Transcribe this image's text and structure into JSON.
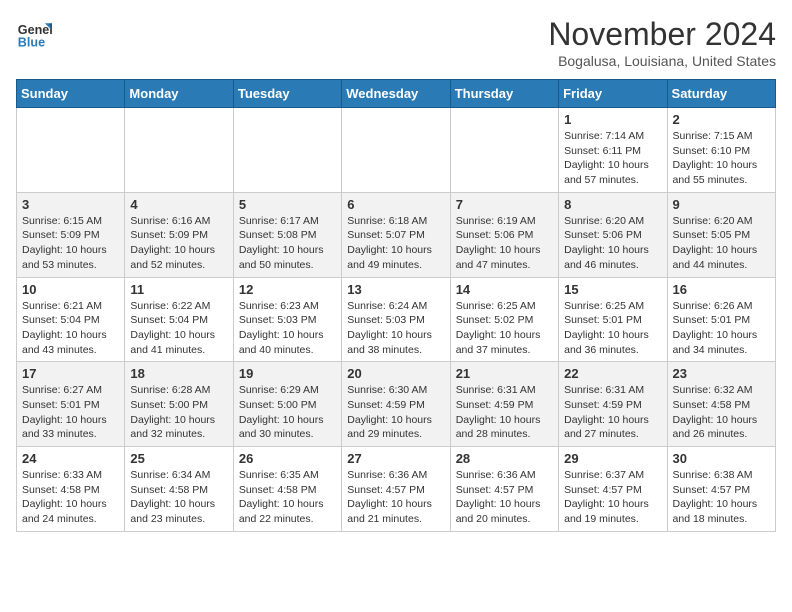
{
  "header": {
    "logo_line1": "General",
    "logo_line2": "Blue",
    "month": "November 2024",
    "location": "Bogalusa, Louisiana, United States"
  },
  "days_of_week": [
    "Sunday",
    "Monday",
    "Tuesday",
    "Wednesday",
    "Thursday",
    "Friday",
    "Saturday"
  ],
  "weeks": [
    [
      {
        "day": "",
        "info": ""
      },
      {
        "day": "",
        "info": ""
      },
      {
        "day": "",
        "info": ""
      },
      {
        "day": "",
        "info": ""
      },
      {
        "day": "",
        "info": ""
      },
      {
        "day": "1",
        "info": "Sunrise: 7:14 AM\nSunset: 6:11 PM\nDaylight: 10 hours and 57 minutes."
      },
      {
        "day": "2",
        "info": "Sunrise: 7:15 AM\nSunset: 6:10 PM\nDaylight: 10 hours and 55 minutes."
      }
    ],
    [
      {
        "day": "3",
        "info": "Sunrise: 6:15 AM\nSunset: 5:09 PM\nDaylight: 10 hours and 53 minutes."
      },
      {
        "day": "4",
        "info": "Sunrise: 6:16 AM\nSunset: 5:09 PM\nDaylight: 10 hours and 52 minutes."
      },
      {
        "day": "5",
        "info": "Sunrise: 6:17 AM\nSunset: 5:08 PM\nDaylight: 10 hours and 50 minutes."
      },
      {
        "day": "6",
        "info": "Sunrise: 6:18 AM\nSunset: 5:07 PM\nDaylight: 10 hours and 49 minutes."
      },
      {
        "day": "7",
        "info": "Sunrise: 6:19 AM\nSunset: 5:06 PM\nDaylight: 10 hours and 47 minutes."
      },
      {
        "day": "8",
        "info": "Sunrise: 6:20 AM\nSunset: 5:06 PM\nDaylight: 10 hours and 46 minutes."
      },
      {
        "day": "9",
        "info": "Sunrise: 6:20 AM\nSunset: 5:05 PM\nDaylight: 10 hours and 44 minutes."
      }
    ],
    [
      {
        "day": "10",
        "info": "Sunrise: 6:21 AM\nSunset: 5:04 PM\nDaylight: 10 hours and 43 minutes."
      },
      {
        "day": "11",
        "info": "Sunrise: 6:22 AM\nSunset: 5:04 PM\nDaylight: 10 hours and 41 minutes."
      },
      {
        "day": "12",
        "info": "Sunrise: 6:23 AM\nSunset: 5:03 PM\nDaylight: 10 hours and 40 minutes."
      },
      {
        "day": "13",
        "info": "Sunrise: 6:24 AM\nSunset: 5:03 PM\nDaylight: 10 hours and 38 minutes."
      },
      {
        "day": "14",
        "info": "Sunrise: 6:25 AM\nSunset: 5:02 PM\nDaylight: 10 hours and 37 minutes."
      },
      {
        "day": "15",
        "info": "Sunrise: 6:25 AM\nSunset: 5:01 PM\nDaylight: 10 hours and 36 minutes."
      },
      {
        "day": "16",
        "info": "Sunrise: 6:26 AM\nSunset: 5:01 PM\nDaylight: 10 hours and 34 minutes."
      }
    ],
    [
      {
        "day": "17",
        "info": "Sunrise: 6:27 AM\nSunset: 5:01 PM\nDaylight: 10 hours and 33 minutes."
      },
      {
        "day": "18",
        "info": "Sunrise: 6:28 AM\nSunset: 5:00 PM\nDaylight: 10 hours and 32 minutes."
      },
      {
        "day": "19",
        "info": "Sunrise: 6:29 AM\nSunset: 5:00 PM\nDaylight: 10 hours and 30 minutes."
      },
      {
        "day": "20",
        "info": "Sunrise: 6:30 AM\nSunset: 4:59 PM\nDaylight: 10 hours and 29 minutes."
      },
      {
        "day": "21",
        "info": "Sunrise: 6:31 AM\nSunset: 4:59 PM\nDaylight: 10 hours and 28 minutes."
      },
      {
        "day": "22",
        "info": "Sunrise: 6:31 AM\nSunset: 4:59 PM\nDaylight: 10 hours and 27 minutes."
      },
      {
        "day": "23",
        "info": "Sunrise: 6:32 AM\nSunset: 4:58 PM\nDaylight: 10 hours and 26 minutes."
      }
    ],
    [
      {
        "day": "24",
        "info": "Sunrise: 6:33 AM\nSunset: 4:58 PM\nDaylight: 10 hours and 24 minutes."
      },
      {
        "day": "25",
        "info": "Sunrise: 6:34 AM\nSunset: 4:58 PM\nDaylight: 10 hours and 23 minutes."
      },
      {
        "day": "26",
        "info": "Sunrise: 6:35 AM\nSunset: 4:58 PM\nDaylight: 10 hours and 22 minutes."
      },
      {
        "day": "27",
        "info": "Sunrise: 6:36 AM\nSunset: 4:57 PM\nDaylight: 10 hours and 21 minutes."
      },
      {
        "day": "28",
        "info": "Sunrise: 6:36 AM\nSunset: 4:57 PM\nDaylight: 10 hours and 20 minutes."
      },
      {
        "day": "29",
        "info": "Sunrise: 6:37 AM\nSunset: 4:57 PM\nDaylight: 10 hours and 19 minutes."
      },
      {
        "day": "30",
        "info": "Sunrise: 6:38 AM\nSunset: 4:57 PM\nDaylight: 10 hours and 18 minutes."
      }
    ]
  ]
}
